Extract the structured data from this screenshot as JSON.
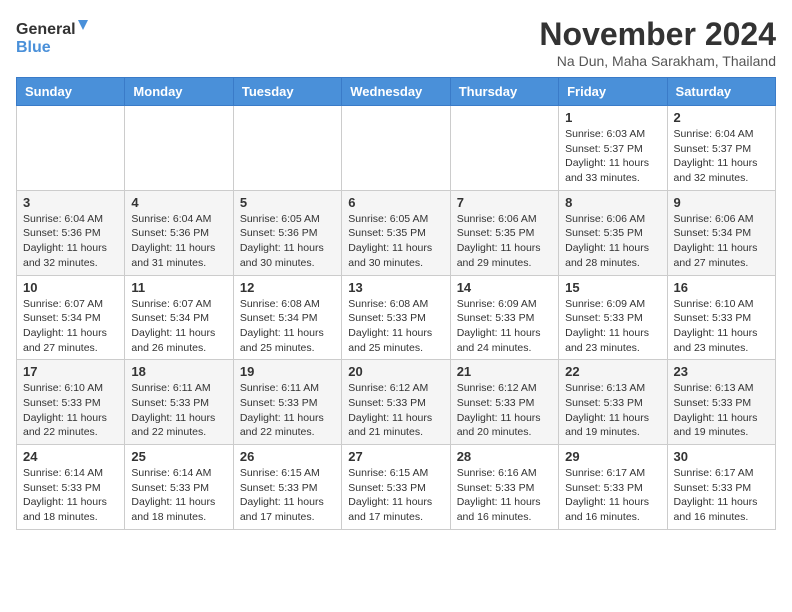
{
  "header": {
    "logo_general": "General",
    "logo_blue": "Blue",
    "month_title": "November 2024",
    "subtitle": "Na Dun, Maha Sarakham, Thailand"
  },
  "weekdays": [
    "Sunday",
    "Monday",
    "Tuesday",
    "Wednesday",
    "Thursday",
    "Friday",
    "Saturday"
  ],
  "weeks": [
    [
      {
        "day": "",
        "info": ""
      },
      {
        "day": "",
        "info": ""
      },
      {
        "day": "",
        "info": ""
      },
      {
        "day": "",
        "info": ""
      },
      {
        "day": "",
        "info": ""
      },
      {
        "day": "1",
        "info": "Sunrise: 6:03 AM\nSunset: 5:37 PM\nDaylight: 11 hours and 33 minutes."
      },
      {
        "day": "2",
        "info": "Sunrise: 6:04 AM\nSunset: 5:37 PM\nDaylight: 11 hours and 32 minutes."
      }
    ],
    [
      {
        "day": "3",
        "info": "Sunrise: 6:04 AM\nSunset: 5:36 PM\nDaylight: 11 hours and 32 minutes."
      },
      {
        "day": "4",
        "info": "Sunrise: 6:04 AM\nSunset: 5:36 PM\nDaylight: 11 hours and 31 minutes."
      },
      {
        "day": "5",
        "info": "Sunrise: 6:05 AM\nSunset: 5:36 PM\nDaylight: 11 hours and 30 minutes."
      },
      {
        "day": "6",
        "info": "Sunrise: 6:05 AM\nSunset: 5:35 PM\nDaylight: 11 hours and 30 minutes."
      },
      {
        "day": "7",
        "info": "Sunrise: 6:06 AM\nSunset: 5:35 PM\nDaylight: 11 hours and 29 minutes."
      },
      {
        "day": "8",
        "info": "Sunrise: 6:06 AM\nSunset: 5:35 PM\nDaylight: 11 hours and 28 minutes."
      },
      {
        "day": "9",
        "info": "Sunrise: 6:06 AM\nSunset: 5:34 PM\nDaylight: 11 hours and 27 minutes."
      }
    ],
    [
      {
        "day": "10",
        "info": "Sunrise: 6:07 AM\nSunset: 5:34 PM\nDaylight: 11 hours and 27 minutes."
      },
      {
        "day": "11",
        "info": "Sunrise: 6:07 AM\nSunset: 5:34 PM\nDaylight: 11 hours and 26 minutes."
      },
      {
        "day": "12",
        "info": "Sunrise: 6:08 AM\nSunset: 5:34 PM\nDaylight: 11 hours and 25 minutes."
      },
      {
        "day": "13",
        "info": "Sunrise: 6:08 AM\nSunset: 5:33 PM\nDaylight: 11 hours and 25 minutes."
      },
      {
        "day": "14",
        "info": "Sunrise: 6:09 AM\nSunset: 5:33 PM\nDaylight: 11 hours and 24 minutes."
      },
      {
        "day": "15",
        "info": "Sunrise: 6:09 AM\nSunset: 5:33 PM\nDaylight: 11 hours and 23 minutes."
      },
      {
        "day": "16",
        "info": "Sunrise: 6:10 AM\nSunset: 5:33 PM\nDaylight: 11 hours and 23 minutes."
      }
    ],
    [
      {
        "day": "17",
        "info": "Sunrise: 6:10 AM\nSunset: 5:33 PM\nDaylight: 11 hours and 22 minutes."
      },
      {
        "day": "18",
        "info": "Sunrise: 6:11 AM\nSunset: 5:33 PM\nDaylight: 11 hours and 22 minutes."
      },
      {
        "day": "19",
        "info": "Sunrise: 6:11 AM\nSunset: 5:33 PM\nDaylight: 11 hours and 22 minutes."
      },
      {
        "day": "20",
        "info": "Sunrise: 6:12 AM\nSunset: 5:33 PM\nDaylight: 11 hours and 21 minutes."
      },
      {
        "day": "21",
        "info": "Sunrise: 6:12 AM\nSunset: 5:33 PM\nDaylight: 11 hours and 20 minutes."
      },
      {
        "day": "22",
        "info": "Sunrise: 6:13 AM\nSunset: 5:33 PM\nDaylight: 11 hours and 19 minutes."
      },
      {
        "day": "23",
        "info": "Sunrise: 6:13 AM\nSunset: 5:33 PM\nDaylight: 11 hours and 19 minutes."
      }
    ],
    [
      {
        "day": "24",
        "info": "Sunrise: 6:14 AM\nSunset: 5:33 PM\nDaylight: 11 hours and 18 minutes."
      },
      {
        "day": "25",
        "info": "Sunrise: 6:14 AM\nSunset: 5:33 PM\nDaylight: 11 hours and 18 minutes."
      },
      {
        "day": "26",
        "info": "Sunrise: 6:15 AM\nSunset: 5:33 PM\nDaylight: 11 hours and 17 minutes."
      },
      {
        "day": "27",
        "info": "Sunrise: 6:15 AM\nSunset: 5:33 PM\nDaylight: 11 hours and 17 minutes."
      },
      {
        "day": "28",
        "info": "Sunrise: 6:16 AM\nSunset: 5:33 PM\nDaylight: 11 hours and 16 minutes."
      },
      {
        "day": "29",
        "info": "Sunrise: 6:17 AM\nSunset: 5:33 PM\nDaylight: 11 hours and 16 minutes."
      },
      {
        "day": "30",
        "info": "Sunrise: 6:17 AM\nSunset: 5:33 PM\nDaylight: 11 hours and 16 minutes."
      }
    ]
  ]
}
